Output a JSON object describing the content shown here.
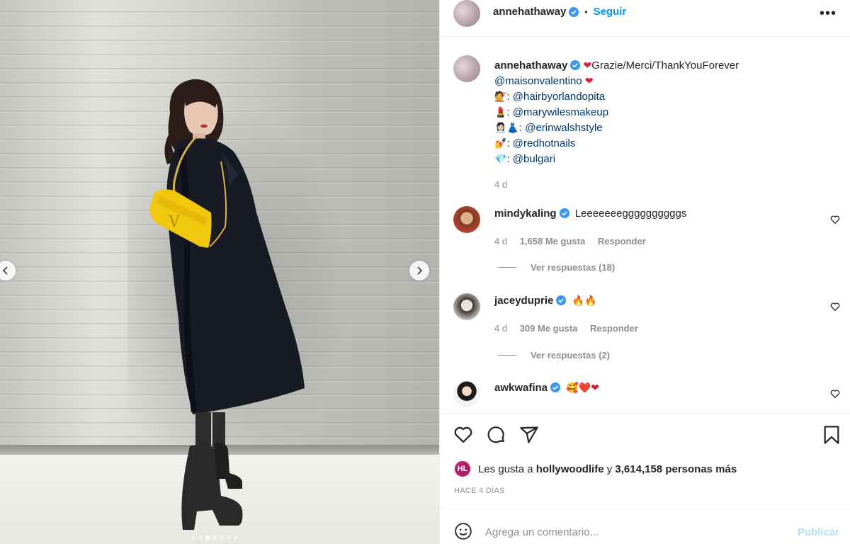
{
  "post": {
    "author": "annehathaway",
    "follow_label": "Seguir",
    "dot": "•",
    "more_label": "•••",
    "photo_nav": {
      "prev": "‹",
      "next": "›"
    }
  },
  "caption": {
    "author": "annehathaway",
    "text": "Grazie/Merci/ThankYouForever",
    "lines": [
      {
        "emoji": "❤",
        "label": "",
        "mention": "@maisonvalentino"
      },
      {
        "emoji": "💇",
        "label": ": ",
        "mention": "@hairbyorlandopita"
      },
      {
        "emoji": "💄",
        "label": ": ",
        "mention": "@marywilesmakeup"
      },
      {
        "emoji": "👩🏻‍💼👗",
        "label": ": ",
        "mention": "@erinwalshstyle"
      },
      {
        "emoji": "💅",
        "label": ": ",
        "mention": "@redhotnails"
      },
      {
        "emoji": "💎",
        "label": ": ",
        "mention": "@bulgari"
      }
    ],
    "time": "4 d"
  },
  "comments": [
    {
      "user": "mindykaling",
      "text": "Leeeeeeeggggggggggs",
      "time": "4 d",
      "likes": "1,658 Me gusta",
      "reply": "Responder",
      "view_replies": "Ver respuestas (18)"
    },
    {
      "user": "jaceyduprie",
      "text": "🔥🔥",
      "time": "4 d",
      "likes": "309 Me gusta",
      "reply": "Responder",
      "view_replies": "Ver respuestas (2)"
    },
    {
      "user": "awkwafina",
      "text": "🥰❤️❤",
      "time": "",
      "likes": "",
      "reply": "",
      "view_replies": ""
    }
  ],
  "likes": {
    "prefix": "Les gusta a",
    "user": "hollywoodlife",
    "middle": "y",
    "count": "3,614,158 personas más",
    "avatar_text": "HL"
  },
  "posted": "HACE 4 DÍAS",
  "comment_input": {
    "placeholder": "Agrega un comentario...",
    "publish": "Publicar"
  },
  "colors": {
    "link": "#0095f6",
    "mention": "#00376b",
    "verified": "#3897f0",
    "muted": "#8e8e8e"
  }
}
